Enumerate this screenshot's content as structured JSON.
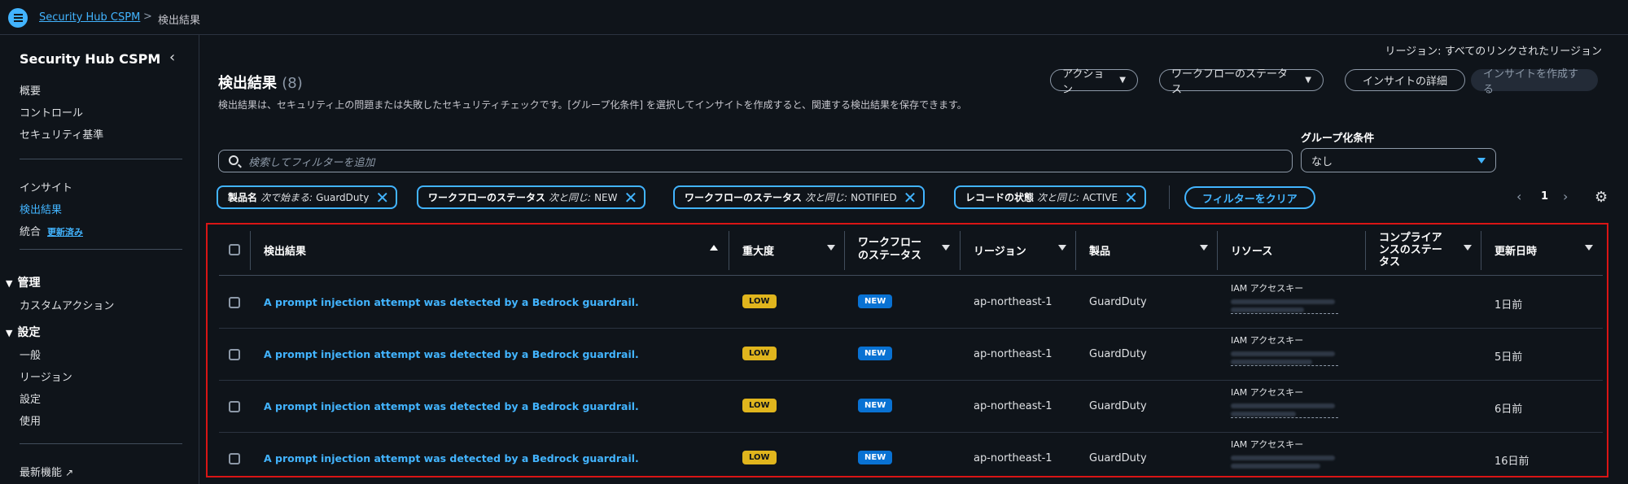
{
  "breadcrumb": {
    "service": "Security Hub CSPM",
    "separator": ">",
    "current": "検出結果"
  },
  "sidebar": {
    "title": "Security Hub CSPM",
    "group1": [
      "概要",
      "コントロール",
      "セキュリティ基準"
    ],
    "group2": [
      "インサイト",
      "検出結果",
      "統合"
    ],
    "integration_badge": "更新済み",
    "section_manage": "管理",
    "manage_items": [
      "カスタムアクション"
    ],
    "section_settings": "設定",
    "settings_items": [
      "一般",
      "リージョン",
      "設定",
      "使用"
    ],
    "new_features": "最新機能"
  },
  "header": {
    "region_label": "リージョン: すべてのリンクされたリージョン",
    "title": "検出結果",
    "count": "(8)",
    "description": "検出結果は、セキュリティ上の問題または失敗したセキュリティチェックです。[グループ化条件] を選択してインサイトを作成すると、関連する検出結果を保存できます。",
    "actions_button": "アクション",
    "workflow_button": "ワークフローのステータス",
    "insight_details_button": "インサイトの詳細",
    "create_insight_button": "インサイトを作成する"
  },
  "search": {
    "placeholder": "検索してフィルターを追加"
  },
  "grouping": {
    "label": "グループ化条件",
    "value": "なし"
  },
  "filters": [
    {
      "field": "製品名",
      "op": "次で始まる:",
      "value": "GuardDuty"
    },
    {
      "field": "ワークフローのステータス",
      "op": "次と同じ:",
      "value": "NEW"
    },
    {
      "field": "ワークフローのステータス",
      "op": "次と同じ:",
      "value": "NOTIFIED"
    },
    {
      "field": "レコードの状態",
      "op": "次と同じ:",
      "value": "ACTIVE"
    }
  ],
  "clear_filters": "フィルターをクリア",
  "pagination": {
    "page": "1"
  },
  "table": {
    "columns": {
      "finding": "検出結果",
      "severity": "重大度",
      "workflow_1": "ワークフロー",
      "workflow_2": "のステータス",
      "region": "リージョン",
      "product": "製品",
      "resource": "リソース",
      "compliance_1": "コンプライア",
      "compliance_2": "ンスのステー",
      "compliance_3": "タス",
      "updated": "更新日時"
    },
    "rows": [
      {
        "title": "A prompt injection attempt was detected by a Bedrock guardrail.",
        "severity": "LOW",
        "workflow": "NEW",
        "region": "ap-northeast-1",
        "product": "GuardDuty",
        "resource_type": "IAM アクセスキー",
        "updated": "1日前"
      },
      {
        "title": "A prompt injection attempt was detected by a Bedrock guardrail.",
        "severity": "LOW",
        "workflow": "NEW",
        "region": "ap-northeast-1",
        "product": "GuardDuty",
        "resource_type": "IAM アクセスキー",
        "updated": "5日前"
      },
      {
        "title": "A prompt injection attempt was detected by a Bedrock guardrail.",
        "severity": "LOW",
        "workflow": "NEW",
        "region": "ap-northeast-1",
        "product": "GuardDuty",
        "resource_type": "IAM アクセスキー",
        "updated": "6日前"
      },
      {
        "title": "A prompt injection attempt was detected by a Bedrock guardrail.",
        "severity": "LOW",
        "workflow": "NEW",
        "region": "ap-northeast-1",
        "product": "GuardDuty",
        "resource_type": "IAM アクセスキー",
        "updated": "16日前"
      }
    ]
  },
  "colors": {
    "accent": "#42b4ff",
    "background": "#0f141a",
    "highlight_border": "#d91515",
    "severity_low": "#e0b51d",
    "status_new": "#0972d3"
  }
}
